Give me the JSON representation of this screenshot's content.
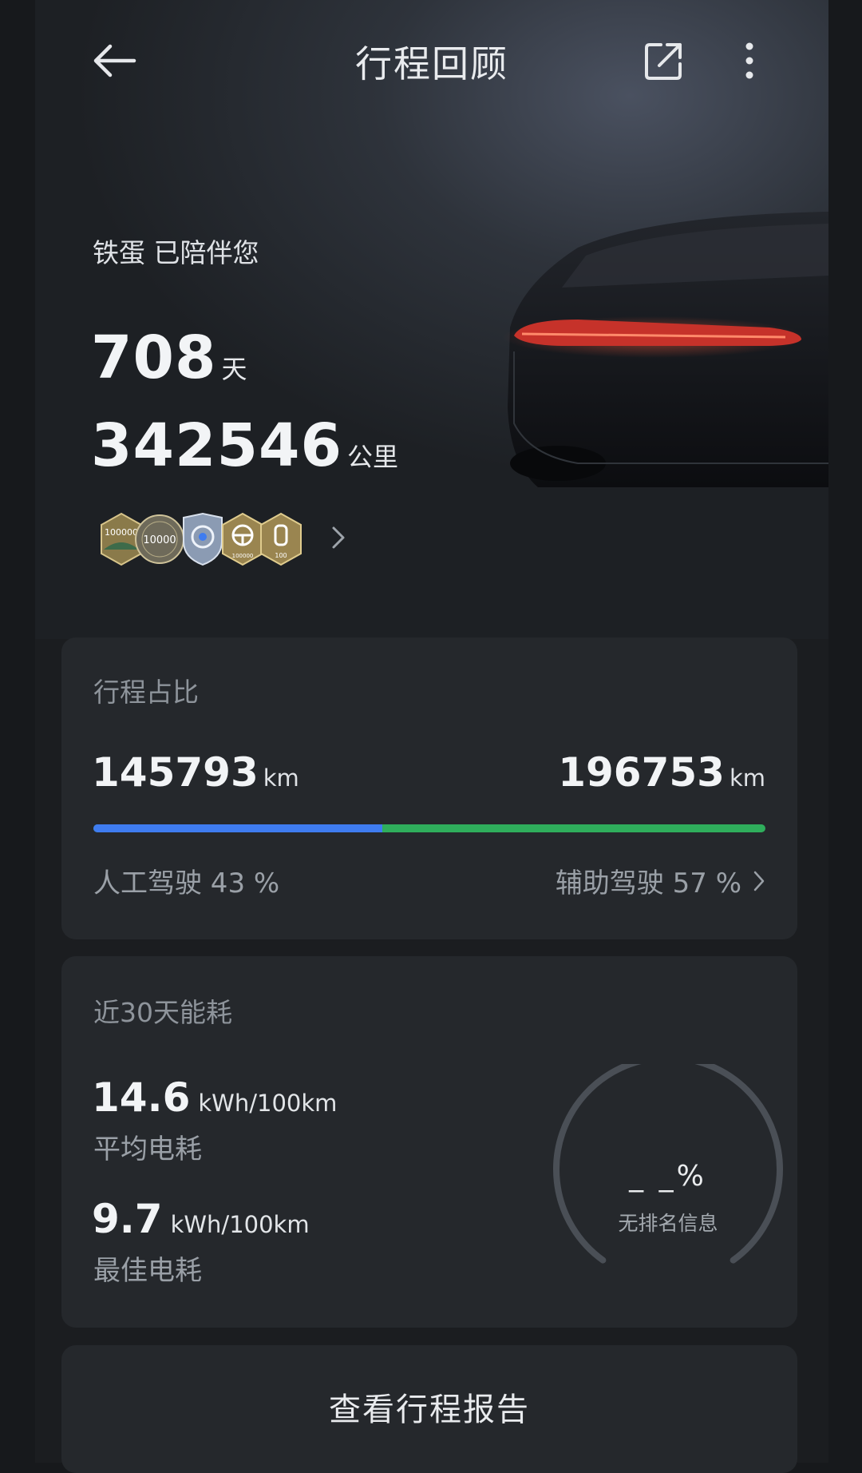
{
  "header": {
    "title": "行程回顾",
    "back_icon": "arrow-left-icon",
    "share_icon": "share-external-icon",
    "more_icon": "more-vertical-icon"
  },
  "summary": {
    "companion_text": "铁蛋 已陪伴您",
    "days_value": "708",
    "days_unit": "天",
    "distance_value": "342546",
    "distance_unit": "公里",
    "badges": [
      {
        "icon": "badge-100000-icon",
        "label": "100000"
      },
      {
        "icon": "badge-10000-icon",
        "label": "10000"
      },
      {
        "icon": "badge-shield-icon",
        "label": ""
      },
      {
        "icon": "badge-steering-icon",
        "label": "100000"
      },
      {
        "icon": "badge-seat-icon",
        "label": "100"
      }
    ]
  },
  "trip_share": {
    "title": "行程占比",
    "manual_km": "145793",
    "assist_km": "196753",
    "unit": "km",
    "manual_label": "人工驾驶 43 %",
    "assist_label": "辅助驾驶 57 %",
    "manual_fraction": 0.43,
    "colors": {
      "manual": "#3f7cf0",
      "assist": "#2fae5c"
    }
  },
  "energy": {
    "title": "近30天能耗",
    "average_value": "14.6",
    "average_unit": "kWh/100km",
    "average_label": "平均电耗",
    "best_value": "9.7",
    "best_unit": "kWh/100km",
    "best_label": "最佳电耗",
    "rank_value": "_ _%",
    "rank_label": "无排名信息"
  },
  "report_button": {
    "label": "查看行程报告"
  }
}
